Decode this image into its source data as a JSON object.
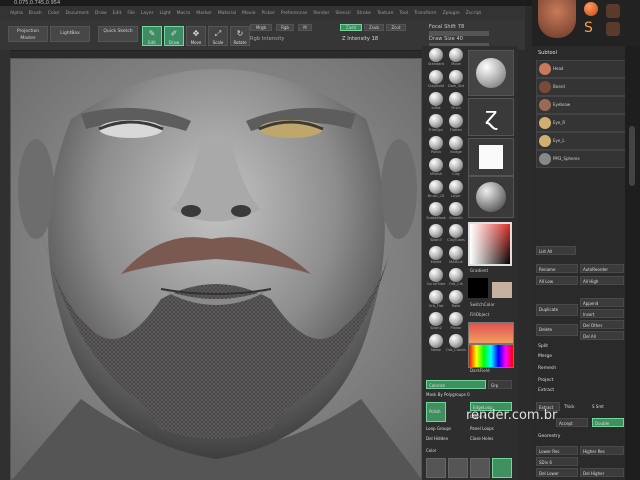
{
  "coord_readout": "0.075,0.745,0.954",
  "menus": [
    "Alpha",
    "Brush",
    "Color",
    "Document",
    "Draw",
    "Edit",
    "File",
    "Layer",
    "Light",
    "Macro",
    "Marker",
    "Material",
    "Movie",
    "Picker",
    "Preferences",
    "Render",
    "Stencil",
    "Stroke",
    "Texture",
    "Tool",
    "Transform",
    "Zplugin",
    "Zscript"
  ],
  "toolbar": {
    "projection_master": "Projection Master",
    "lightbox": "LightBox",
    "quick_sketch": "Quick Sketch",
    "edit": "Edit",
    "draw": "Draw",
    "move": "Move",
    "scale": "Scale",
    "rotate": "Rotate",
    "mrgb": "Mrgb",
    "rgb": "Rgb",
    "m": "M",
    "zadd": "Zadd",
    "zsub": "Zsub",
    "zcut": "Zcut",
    "rgb_intensity": "Rgb Intensity",
    "z_intensity": "Z Intensity 18",
    "focal_shift": "Focal Shift 78",
    "draw_size": "Draw Size 40"
  },
  "brushes": [
    "Standard",
    "Move",
    "ClayBuild",
    "Dam_Std",
    "Inflat",
    "Pinch",
    "TrimDyn",
    "Flatten",
    "Polish",
    "Nudge",
    "hPolish",
    "Clay",
    "Brush_Ctl",
    "Layer",
    "SnakeHook",
    "Smooth",
    "Slash3",
    "ClayTubes",
    "Mallet",
    "MAHcut",
    "CurveTube",
    "Orb_Crk",
    "Orb_Flat",
    "Rake",
    "Slash2",
    "Planar",
    "Noise",
    "Orb_Cracks"
  ],
  "palette": {
    "gradient_label": "Gradient",
    "switch_color": "SwitchColor",
    "fill_object": "FillObject",
    "colorize": "Colorize",
    "mask_by_polygroups": "Mask By Polygroups 0",
    "grp": "Grp",
    "edgeloop": "EdgeLoop",
    "loops": "Loops 4",
    "polish": "Polish",
    "loop_groups": "Loop Groups",
    "panel_loops": "Panel Loops",
    "del_hidden": "Del Hidden",
    "close_holes": "Close Holes",
    "dark_field": "DarkField",
    "color_label": "Color"
  },
  "subtools": {
    "header": "Subtool",
    "items": [
      "Head",
      "Beard",
      "Eyebrow",
      "Eye_R",
      "Eye_L",
      "PM3_Spheres"
    ],
    "list_all": "List All",
    "rename": "Rename",
    "auto_reorder": "AutoReorder",
    "all_low": "All Low",
    "all_high": "All High",
    "duplicate": "Duplicate",
    "append": "Append",
    "insert": "Insert",
    "del_other": "Del Other",
    "delete": "Delete",
    "del_all": "Del All",
    "split": "Split",
    "merge": "Merge",
    "remesh": "Remesh",
    "project": "Project",
    "extract": "Extract",
    "thick": "Thick",
    "s_smt": "S Smt",
    "double": "Double",
    "accept": "Accept",
    "geometry": "Geometry",
    "lower_res": "Lower Res",
    "higher_res": "Higher Res",
    "sdiv": "SDiv 6",
    "del_lower": "Del Lower",
    "del_higher": "Del Higher"
  },
  "watermark": "render.com.br",
  "colors": {
    "accent": "#3f8f5f",
    "bg": "#2b2b2b"
  }
}
